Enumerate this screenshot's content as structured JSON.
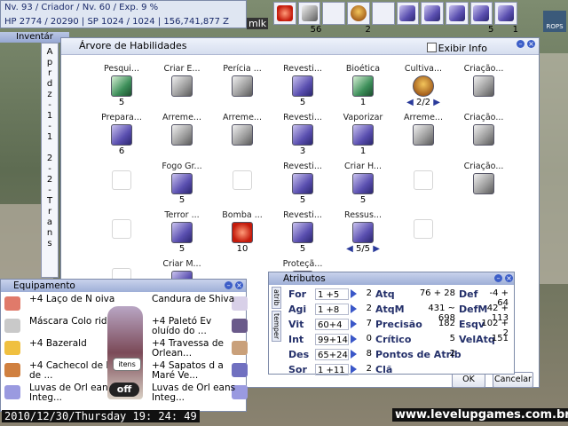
{
  "status": {
    "line1": "Nv. 93 / Criador / Nv. 60 / Exp. 9 %",
    "line2": "HP  2774 / 20290  |  SP  1024 / 1024  |  156,741,877 Z"
  },
  "name_tag": "mlk",
  "hotbar": {
    "slot2_count": "56",
    "slot4_count": "2",
    "slot9_count": "5",
    "slot10_count": "1"
  },
  "rops_label": "ROPS",
  "inventory": {
    "title": "Inventár",
    "strip_tab1": [
      "A",
      "p",
      "r",
      "d",
      "z",
      "-",
      "1",
      "-",
      "1"
    ],
    "strip_tab2": [
      "2",
      "-",
      "2",
      "-",
      "T",
      "r",
      "a",
      "n",
      "s"
    ]
  },
  "skill_tree": {
    "title": "Árvore de Habilidades",
    "show_info_label": "Exibir Info",
    "skills": [
      {
        "name": "Pesqui...",
        "level": "5"
      },
      {
        "name": "Criar E...",
        "level": ""
      },
      {
        "name": "Perícia ...",
        "level": ""
      },
      {
        "name": "Revesti...",
        "level": "5"
      },
      {
        "name": "Bioética",
        "level": "1"
      },
      {
        "name": "Cultiva...",
        "level": "2/2"
      },
      {
        "name": "Criação...",
        "level": ""
      },
      {
        "name": "Prepara...",
        "level": "6"
      },
      {
        "name": "Arreme...",
        "level": ""
      },
      {
        "name": "Arreme...",
        "level": ""
      },
      {
        "name": "Revesti...",
        "level": "3"
      },
      {
        "name": "Vaporizar",
        "level": "1"
      },
      {
        "name": "Arreme...",
        "level": ""
      },
      {
        "name": "Criação...",
        "level": ""
      },
      {
        "name": "Fogo Gr...",
        "level": "5"
      },
      {
        "name": "Revesti...",
        "level": "5"
      },
      {
        "name": "Criar H...",
        "level": "5"
      },
      {
        "name": "Criação...",
        "level": ""
      },
      {
        "name": "Terror ...",
        "level": "5"
      },
      {
        "name": "Bomba ...",
        "level": "10"
      },
      {
        "name": "Revesti...",
        "level": "5"
      },
      {
        "name": "Ressus...",
        "level": "5/5"
      },
      {
        "name": "Criar M...",
        "level": ""
      },
      {
        "name": "Proteçã...",
        "level": ""
      }
    ],
    "ok_label": "OK",
    "cancel_label": "Cancelar"
  },
  "equipment": {
    "title": "Equipamento",
    "left": [
      {
        "text": "+4 Laço de N oiva"
      },
      {
        "text": "Máscara Colo rida"
      },
      {
        "text": "+4 Bazerald"
      },
      {
        "text": "+4 Cachecol de Lã de ..."
      },
      {
        "text": "Luvas de Orl eans Integ..."
      }
    ],
    "right": [
      {
        "text": "Candura de Shiva"
      },
      {
        "text": "+4 Paletó Ev oluído do ..."
      },
      {
        "text": "+4 Travessa de Orlean..."
      },
      {
        "text": "+4 Sapatos d a Maré Ve..."
      },
      {
        "text": "Luvas de Orl eans Integ..."
      }
    ],
    "itens_label": "itens",
    "off_label": "off"
  },
  "attributes": {
    "title": "Atributos",
    "tab1": "atrib",
    "tab2": "temper",
    "rows": [
      {
        "stat": "For",
        "value": "1 +5",
        "cost": "2",
        "sub": "Atq",
        "sub_value": "76 + 28",
        "sub2": "Def",
        "sub2_value": "-4 + 64"
      },
      {
        "stat": "Agi",
        "value": "1 +8",
        "cost": "2",
        "sub": "AtqM",
        "sub_value": "431 ~ 698",
        "sub2": "DefM",
        "sub2_value": "42 + 113"
      },
      {
        "stat": "Vit",
        "value": "60+4",
        "cost": "7",
        "sub": "Precisão",
        "sub_value": "182",
        "sub2": "Esqv",
        "sub2_value": "102 + 2"
      },
      {
        "stat": "Int",
        "value": "99+14",
        "cost": "0",
        "sub": "Crítico",
        "sub_value": "5",
        "sub2": "VelAtq",
        "sub2_value": "151"
      },
      {
        "stat": "Des",
        "value": "65+24",
        "cost": "8",
        "sub": "Pontos de Atrib",
        "sub_value": "2",
        "sub2": "",
        "sub2_value": ""
      },
      {
        "stat": "Sor",
        "value": "1 +11",
        "cost": "2",
        "sub": "Clã",
        "sub_value": "",
        "sub2": "",
        "sub2_value": ""
      }
    ]
  },
  "clock": "2010/12/30/Thursday  19: 24: 49",
  "watermark": "www.levelupgames.com.br"
}
